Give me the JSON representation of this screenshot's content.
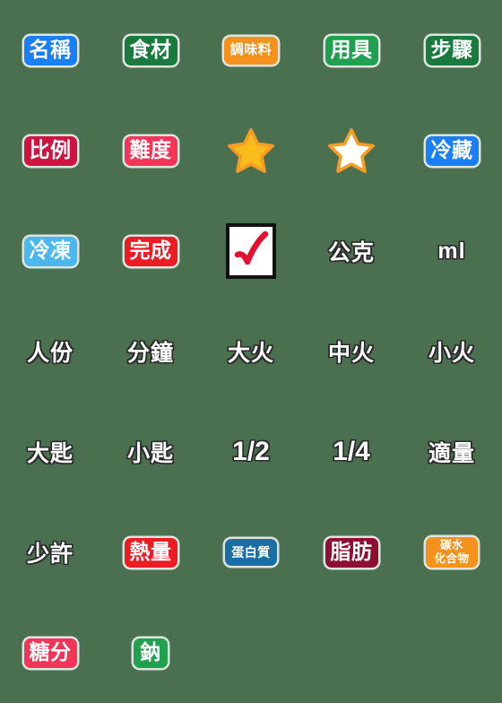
{
  "sheet": {
    "background_color": "#4a7050",
    "columns": 5,
    "rows": 7,
    "total_stickers": 32
  },
  "palette": {
    "blue": "#1a7ef5",
    "light_blue": "#4ab8ee",
    "green": "#1a7a3e",
    "bright_green": "#21a04f",
    "orange": "#f5921e",
    "crimson": "#cf1441",
    "pink_red": "#f23558",
    "red": "#ec1c24",
    "steel_blue": "#1b6ea3",
    "maroon": "#8f0f33",
    "star_gold": "#f9bc1b",
    "star_outline": "#f79d26",
    "check_red": "#e31230",
    "white": "#ffffff",
    "outline_dark": "#2b2b2b"
  },
  "stickers": [
    {
      "id": "ming-cheng",
      "text": "名稱",
      "kind": "badge",
      "size": "sz-2",
      "bg": "#1a7ef5"
    },
    {
      "id": "shi-cai",
      "text": "食材",
      "kind": "badge",
      "size": "sz-2",
      "bg": "#1a7a3e"
    },
    {
      "id": "tiao-wei-liao",
      "text": "調味料",
      "kind": "badge",
      "size": "sz-4",
      "bg": "#f5921e"
    },
    {
      "id": "yong-ju",
      "text": "用具",
      "kind": "badge",
      "size": "sz-2",
      "bg": "#21a04f"
    },
    {
      "id": "bu-zhou",
      "text": "步驟",
      "kind": "badge",
      "size": "sz-2",
      "bg": "#1a7a3e"
    },
    {
      "id": "bi-li",
      "text": "比例",
      "kind": "badge",
      "size": "sz-2",
      "bg": "#cf1441"
    },
    {
      "id": "nan-du",
      "text": "難度",
      "kind": "badge",
      "size": "sz-2",
      "bg": "#f23558"
    },
    {
      "id": "star-filled",
      "text": "",
      "kind": "star-filled"
    },
    {
      "id": "star-empty",
      "text": "",
      "kind": "star-empty"
    },
    {
      "id": "leng-cang",
      "text": "冷藏",
      "kind": "badge",
      "size": "sz-2",
      "bg": "#1a7ef5"
    },
    {
      "id": "leng-dong",
      "text": "冷凍",
      "kind": "badge",
      "size": "sz-2",
      "bg": "#4ab8ee"
    },
    {
      "id": "wan-cheng",
      "text": "完成",
      "kind": "badge",
      "size": "sz-2",
      "bg": "#ec1c24"
    },
    {
      "id": "checkbox",
      "text": "",
      "kind": "checkbox"
    },
    {
      "id": "gong-ke",
      "text": "公克",
      "kind": "plain"
    },
    {
      "id": "ml",
      "text": "ml",
      "kind": "plain"
    },
    {
      "id": "ren-fen",
      "text": "人份",
      "kind": "plain"
    },
    {
      "id": "fen-zhong",
      "text": "分鐘",
      "kind": "plain"
    },
    {
      "id": "da-huo",
      "text": "大火",
      "kind": "plain"
    },
    {
      "id": "zhong-huo",
      "text": "中火",
      "kind": "plain"
    },
    {
      "id": "xiao-huo",
      "text": "小火",
      "kind": "plain"
    },
    {
      "id": "da-chi",
      "text": "大匙",
      "kind": "plain"
    },
    {
      "id": "xiao-chi",
      "text": "小匙",
      "kind": "plain"
    },
    {
      "id": "one-half",
      "text": "1/2",
      "kind": "plain-num"
    },
    {
      "id": "one-quarter",
      "text": "1/4",
      "kind": "plain-num"
    },
    {
      "id": "shi-liang",
      "text": "適量",
      "kind": "plain"
    },
    {
      "id": "shao-xu",
      "text": "少許",
      "kind": "plain"
    },
    {
      "id": "re-liang",
      "text": "熱量",
      "kind": "badge",
      "size": "sz-2",
      "bg": "#ec1c24"
    },
    {
      "id": "dan-bai-zhi",
      "text": "蛋白質",
      "kind": "badge",
      "size": "sz-3",
      "bg": "#1b6ea3"
    },
    {
      "id": "zhi-fang",
      "text": "脂肪",
      "kind": "badge",
      "size": "sz-2",
      "bg": "#8f0f33"
    },
    {
      "id": "tan-shui",
      "text": "",
      "kind": "badge-stack",
      "size": "sz-stack",
      "bg": "#f5921e",
      "line1": "碳水",
      "line2": "化合物"
    },
    {
      "id": "tang-fen",
      "text": "糖分",
      "kind": "badge",
      "size": "sz-2",
      "bg": "#f23558"
    },
    {
      "id": "na",
      "text": "鈉",
      "kind": "badge",
      "size": "sz-1",
      "bg": "#21a04f"
    }
  ]
}
